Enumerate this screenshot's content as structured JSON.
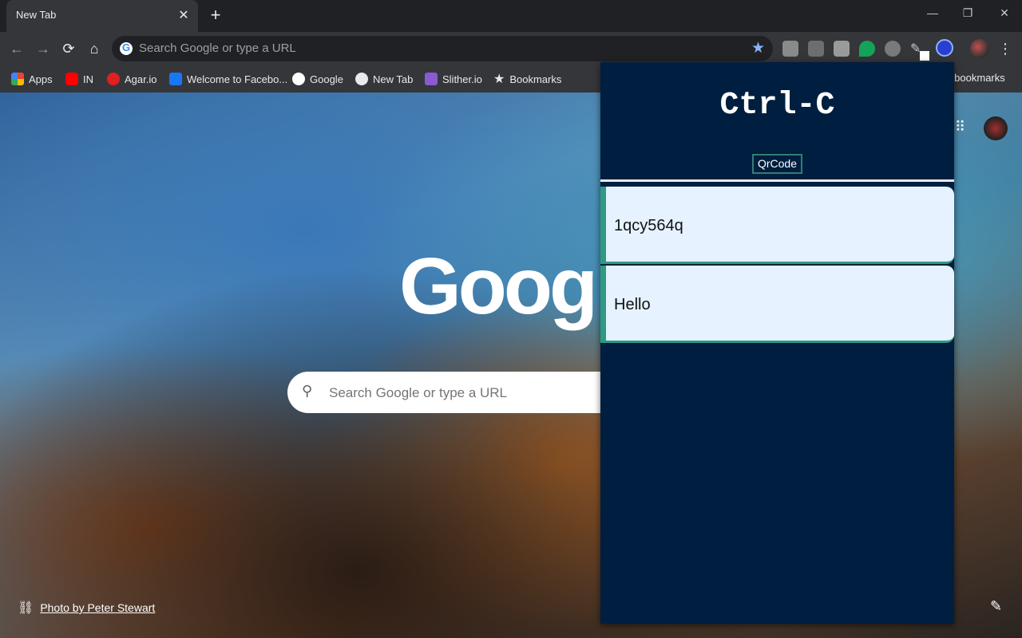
{
  "browser": {
    "tab": {
      "title": "New Tab",
      "close_glyph": "✕"
    },
    "new_tab_glyph": "+",
    "window_controls": {
      "minimize": "—",
      "restore": "❐",
      "close": "✕"
    },
    "nav": {
      "back": "←",
      "forward": "→",
      "reload": "⟳",
      "home": "⌂"
    },
    "omnibox": {
      "placeholder": "Search Google or type a URL",
      "star": "★"
    },
    "menu_glyph": "⋮"
  },
  "bookmarks": {
    "items": [
      {
        "label": "Apps",
        "icon": "apps-grid-icon",
        "color": "#e06030"
      },
      {
        "label": "IN",
        "icon": "youtube-icon",
        "color": "#ff0000"
      },
      {
        "label": "Agar.io",
        "icon": "agar-icon",
        "color": "#e02020"
      },
      {
        "label": "Welcome to Facebo...",
        "icon": "facebook-icon",
        "color": "#1877f2"
      },
      {
        "label": "Google",
        "icon": "google-icon",
        "color": "#ffffff"
      },
      {
        "label": "New Tab",
        "icon": "globe-icon",
        "color": "#e8eaed"
      },
      {
        "label": "Slither.io",
        "icon": "slither-icon",
        "color": "#8a5ad0"
      },
      {
        "label": "Bookmarks",
        "icon": "star-icon",
        "color": "#e8eaed"
      }
    ],
    "other": "er bookmarks"
  },
  "ntp": {
    "logo": "Google",
    "search_placeholder": "Search Google or type a URL",
    "search_glyph": "⚲",
    "photo_credit": "Photo by Peter Stewart",
    "link_glyph": "⛓",
    "apps_glyph": "⠿",
    "edit_glyph": "✎"
  },
  "popup": {
    "title": "Ctrl-C",
    "qr_button": "QrCode",
    "clips": [
      {
        "text": "1qcy564q"
      },
      {
        "text": "Hello"
      }
    ],
    "colors": {
      "background": "#001e3f",
      "accent": "#2f9a84",
      "card": "#e6f2ff"
    }
  }
}
